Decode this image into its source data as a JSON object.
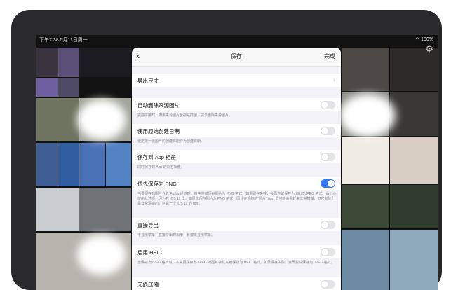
{
  "status": {
    "time": "下午7:38",
    "date": "5月11日周一",
    "right": "100%"
  },
  "sheet": {
    "title": "保存",
    "done": "完成",
    "export_size": "导出尺寸",
    "rows": [
      {
        "label": "自动删除来源图片",
        "note": "完成拼接时，如果来源图片全都是截图，提示删除来源图片。",
        "on": false
      },
      {
        "label": "使用原始创建日期",
        "note": "使用第一张图片的创建日期作为创建日期。",
        "on": false
      },
      {
        "label": "保存到 App 相册",
        "note": "同时保存到 App 的同名相册。",
        "on": false
      },
      {
        "label": "优先保存为 PNG",
        "note": "当要保存的图片含有 Alpha 通道时，首先尝试保存图片为 PNG 格式，如果保存失败，会再尝试保存为 HEIC/JPEG 格式。请小心使用此选项，因为在 iOS 11 里，如果你保存图片为 PNG 格式，图片在系统的“照片” App 里可能会看起来非常模糊，但它实际上是非常清晰的，这是一个 iOS 11 的 bug。",
        "on": true
      },
      {
        "label": "直接导出",
        "note": "不显示菜单，直接导出到相册，长按来显示菜单。",
        "on": false
      },
      {
        "label": "启用 HEIC",
        "note": "当保存为JPEG 格式时，本来要保存为 JPEG 的图片会优先被保存为 HEIC 格式，如果保存失败，会再尝试保存为 JPEG 格式。",
        "on": false
      },
      {
        "label": "无损压缩",
        "note": "",
        "on": false
      }
    ]
  }
}
